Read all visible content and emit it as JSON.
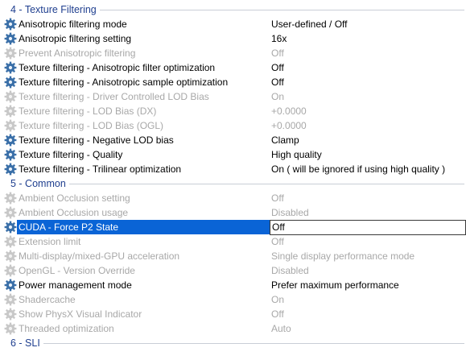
{
  "sections": [
    {
      "title": "4 - Texture Filtering",
      "rows": [
        {
          "name": "Anisotropic filtering mode",
          "value": "User-defined / Off",
          "enabled": true,
          "selected": false
        },
        {
          "name": "Anisotropic filtering setting",
          "value": "16x",
          "enabled": true,
          "selected": false
        },
        {
          "name": "Prevent Anisotropic filtering",
          "value": "Off",
          "enabled": false,
          "selected": false
        },
        {
          "name": "Texture filtering - Anisotropic filter optimization",
          "value": "Off",
          "enabled": true,
          "selected": false
        },
        {
          "name": "Texture filtering - Anisotropic sample optimization",
          "value": "Off",
          "enabled": true,
          "selected": false
        },
        {
          "name": "Texture filtering - Driver Controlled LOD Bias",
          "value": "On",
          "enabled": false,
          "selected": false
        },
        {
          "name": "Texture filtering - LOD Bias (DX)",
          "value": "+0.0000",
          "enabled": false,
          "selected": false
        },
        {
          "name": "Texture filtering - LOD Bias (OGL)",
          "value": "+0.0000",
          "enabled": false,
          "selected": false
        },
        {
          "name": "Texture filtering - Negative LOD bias",
          "value": "Clamp",
          "enabled": true,
          "selected": false
        },
        {
          "name": "Texture filtering - Quality",
          "value": "High quality",
          "enabled": true,
          "selected": false
        },
        {
          "name": "Texture filtering - Trilinear optimization",
          "value": "On ( will be ignored if using high quality )",
          "enabled": true,
          "selected": false
        }
      ]
    },
    {
      "title": "5 - Common",
      "rows": [
        {
          "name": "Ambient Occlusion setting",
          "value": "Off",
          "enabled": false,
          "selected": false
        },
        {
          "name": "Ambient Occlusion usage",
          "value": "Disabled",
          "enabled": false,
          "selected": false
        },
        {
          "name": "CUDA - Force P2 State",
          "value": "Off",
          "enabled": true,
          "selected": true
        },
        {
          "name": "Extension limit",
          "value": "Off",
          "enabled": false,
          "selected": false
        },
        {
          "name": "Multi-display/mixed-GPU acceleration",
          "value": "Single display performance mode",
          "enabled": false,
          "selected": false
        },
        {
          "name": "OpenGL - Version Override",
          "value": "Disabled",
          "enabled": false,
          "selected": false
        },
        {
          "name": "Power management mode",
          "value": "Prefer maximum performance",
          "enabled": true,
          "selected": false
        },
        {
          "name": "Shadercache",
          "value": "On",
          "enabled": false,
          "selected": false
        },
        {
          "name": "Show PhysX Visual Indicator",
          "value": "Off",
          "enabled": false,
          "selected": false
        },
        {
          "name": "Threaded optimization",
          "value": "Auto",
          "enabled": false,
          "selected": false
        }
      ]
    },
    {
      "title": "6 - SLI",
      "rows": []
    }
  ],
  "icons": {
    "enabled": "gear-icon",
    "disabled": "gear-icon-disabled"
  },
  "colors": {
    "section_title": "#1f3f8f",
    "disabled_text": "#a8a8a8",
    "selection": "#0a64d6",
    "gear_enabled": "#3a6fa8",
    "gear_disabled": "#c8c8c8"
  }
}
